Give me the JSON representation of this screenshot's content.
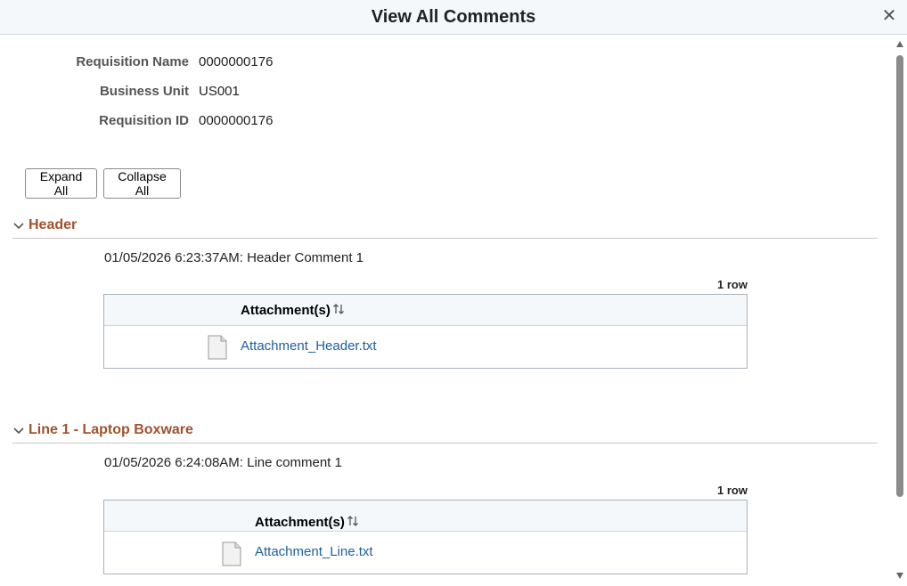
{
  "window": {
    "title": "View All Comments",
    "close_icon": "close-icon"
  },
  "fields": [
    {
      "label": "Requisition Name",
      "value": "0000000176"
    },
    {
      "label": "Business Unit",
      "value": "US001"
    },
    {
      "label": "Requisition ID",
      "value": "0000000176"
    }
  ],
  "toolbar": {
    "expand_all": "Expand All",
    "collapse_all": "Collapse All"
  },
  "sections": [
    {
      "title": "Header",
      "comment": "01/05/2026  6:23:37AM: Header Comment 1",
      "row_count": "1 row",
      "grid": {
        "column_header": "Attachment(s)",
        "rows": [
          {
            "file_name": "Attachment_Header.txt",
            "icon": "file-icon"
          }
        ]
      }
    },
    {
      "title": "Line 1 - Laptop Boxware",
      "comment": "01/05/2026  6:24:08AM: Line comment 1",
      "row_count": "1 row",
      "grid": {
        "column_header": "Attachment(s)",
        "rows": [
          {
            "file_name": "Attachment_Line.txt",
            "icon": "file-icon"
          }
        ]
      }
    }
  ],
  "colors": {
    "section_title": "#a0522d",
    "link": "#1d5fa3",
    "header_bg": "#f4f8fb"
  }
}
